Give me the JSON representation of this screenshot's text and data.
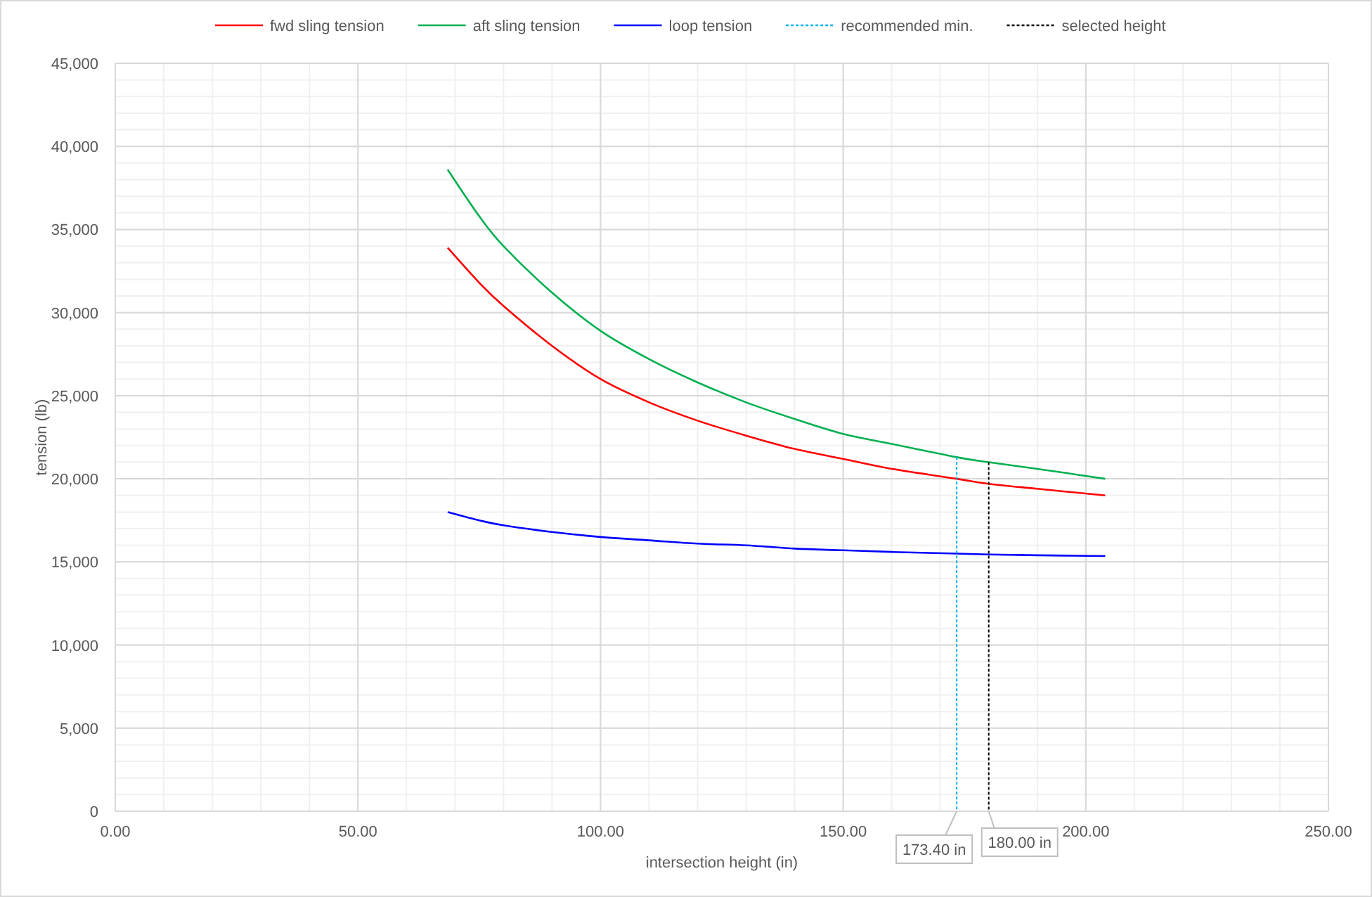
{
  "chart": {
    "chart_data": {
      "type": "line",
      "xlabel": "intersection height (in)",
      "ylabel": "tension (lb)",
      "x": [
        68.5,
        75,
        80,
        90,
        100,
        110,
        120,
        130,
        140,
        150,
        160,
        173.4,
        180,
        190,
        204
      ],
      "series": [
        {
          "name": "fwd sling tension",
          "color": "#ff0000",
          "values": [
            33900,
            31800,
            30400,
            28000,
            26000,
            24600,
            23500,
            22600,
            21800,
            21200,
            20600,
            20000,
            19700,
            19400,
            19000
          ]
        },
        {
          "name": "aft sling tension",
          "color": "#00b050",
          "values": [
            38600,
            35800,
            34000,
            31200,
            28900,
            27200,
            25800,
            24600,
            23600,
            22700,
            22100,
            21300,
            21000,
            20600,
            20000
          ]
        },
        {
          "name": "loop tension",
          "color": "#0000ff",
          "values": [
            18000,
            17500,
            17200,
            16800,
            16500,
            16300,
            16100,
            16000,
            15800,
            15700,
            15600,
            15500,
            15450,
            15400,
            15350
          ]
        }
      ],
      "xlim": [
        0,
        250
      ],
      "ylim": [
        0,
        45000
      ],
      "xticks": [
        {
          "value": 0,
          "label": "0.00"
        },
        {
          "value": 50,
          "label": "50.00"
        },
        {
          "value": 100,
          "label": "100.00"
        },
        {
          "value": 150,
          "label": "150.00"
        },
        {
          "value": 200,
          "label": "200.00"
        },
        {
          "value": 250,
          "label": "250.00"
        }
      ],
      "yticks": [
        {
          "value": 0,
          "label": "0"
        },
        {
          "value": 5000,
          "label": "5,000"
        },
        {
          "value": 10000,
          "label": "10,000"
        },
        {
          "value": 15000,
          "label": "15,000"
        },
        {
          "value": 20000,
          "label": "20,000"
        },
        {
          "value": 25000,
          "label": "25,000"
        },
        {
          "value": 30000,
          "label": "30,000"
        },
        {
          "value": 35000,
          "label": "35,000"
        },
        {
          "value": 40000,
          "label": "40,000"
        },
        {
          "value": 45000,
          "label": "45,000"
        }
      ],
      "grid": true,
      "legend": "top",
      "ref_lines": [
        {
          "axis": "x",
          "value": 173.4,
          "label": "recommended min.",
          "color": "#00b0f0"
        },
        {
          "axis": "x",
          "value": 180,
          "label": "selected height",
          "color": "#000000"
        }
      ],
      "annotations": [
        "173.40 in",
        "180.00 in"
      ]
    }
  }
}
